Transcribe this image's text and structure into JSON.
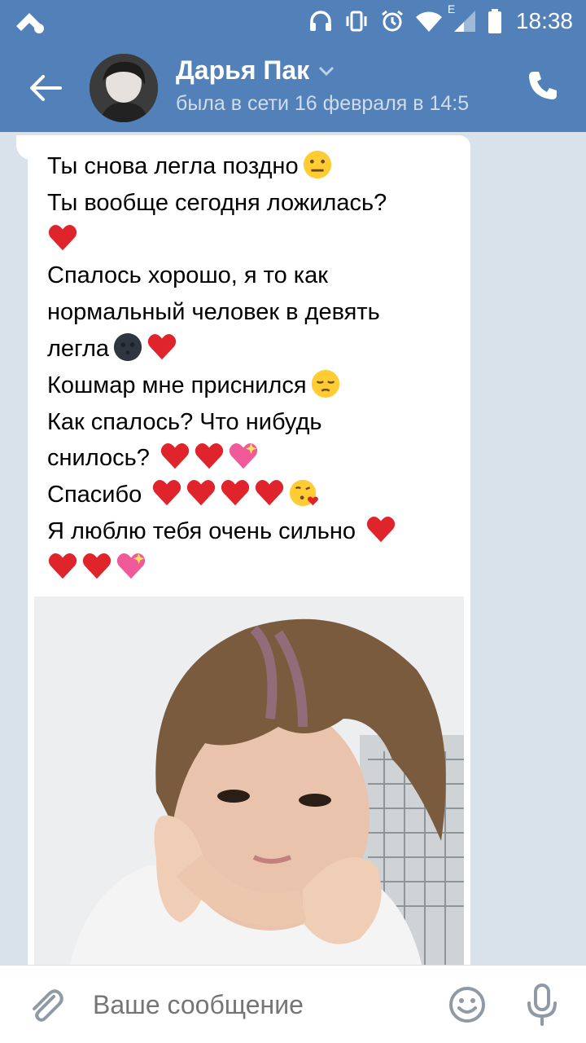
{
  "status_bar": {
    "time": "18:38",
    "network": "E"
  },
  "header": {
    "contact_name": "Дарья Пак",
    "last_seen": "была в сети 16 февраля в 14:5"
  },
  "message": {
    "lines": [
      "Ты снова легла поздно",
      "Ты вообще сегодня ложилась?",
      "",
      "Спалось хорошо, я то как",
      "нормальный человек в девять",
      "легла",
      "Кошмар мне приснился",
      "Как спалось? Что нибудь",
      "снилось?",
      "Спасибо",
      "Я люблю тебя очень сильно",
      ""
    ]
  },
  "composer": {
    "placeholder": "Ваше сообщение"
  },
  "colors": {
    "header": "#5181b8",
    "chat_bg": "#d9e1ea",
    "heart": "#e0242b"
  }
}
